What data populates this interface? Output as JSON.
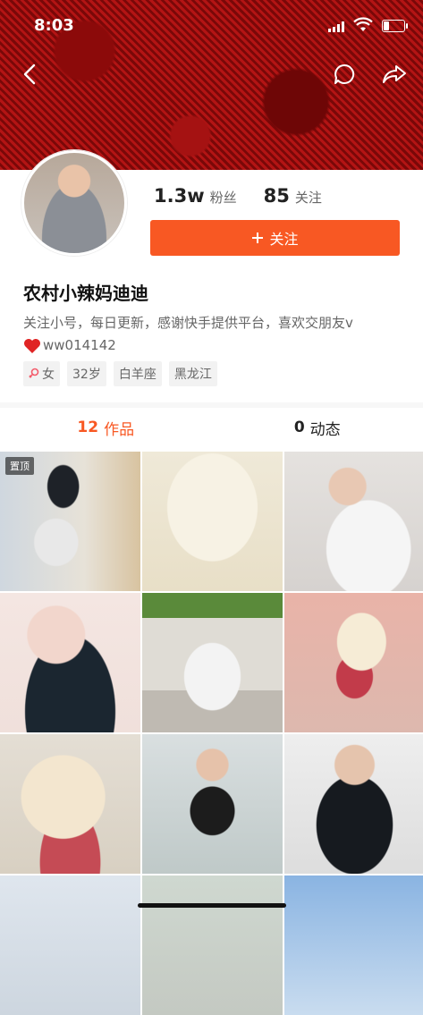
{
  "status_bar": {
    "time": "8:03"
  },
  "profile": {
    "fans_count": "1.3w",
    "fans_label": "粉丝",
    "following_count": "85",
    "following_label": "关注",
    "follow_button": "关注",
    "name": "农村小辣妈迪迪",
    "bio_line1": "关注小号，每日更新，感谢快手提供平台，喜欢交朋友v",
    "bio_line2": "ww014142",
    "tags": [
      "女",
      "32岁",
      "白羊座",
      "黑龙江"
    ]
  },
  "tabs": [
    {
      "count": "12",
      "label": "作品"
    },
    {
      "count": "0",
      "label": "动态"
    }
  ],
  "grid": {
    "pinned_label": "置顶"
  },
  "colors": {
    "accent": "#f85823",
    "banner": "#b31414"
  },
  "icons": [
    "back-icon",
    "comment-icon",
    "share-icon",
    "plus-icon",
    "female-icon",
    "heart-icon"
  ]
}
